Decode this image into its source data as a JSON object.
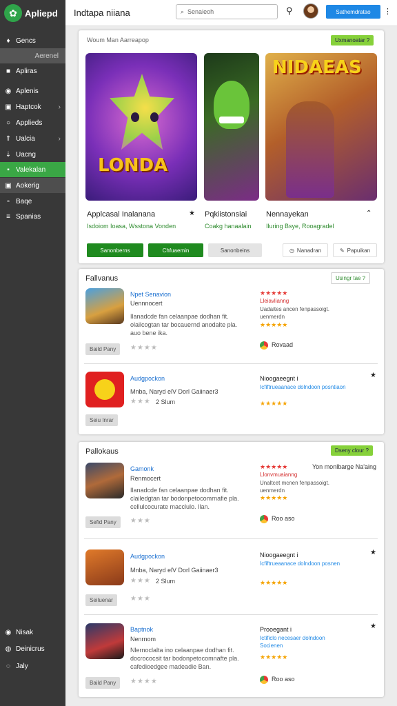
{
  "sidebar": {
    "logo": "Apliepd",
    "items": [
      {
        "label": "Gencs",
        "icon": "tag"
      },
      {
        "label": "Aerenel",
        "icon": ""
      },
      {
        "label": "Apliras",
        "icon": "square"
      },
      {
        "label": "Aplenis",
        "icon": "circle"
      },
      {
        "label": "Haptcok",
        "icon": "box"
      },
      {
        "label": "Applieds",
        "icon": "circle-o"
      },
      {
        "label": "Ualcia",
        "icon": "arrow"
      },
      {
        "label": "Uacng",
        "icon": "arrow-down"
      },
      {
        "label": "Valekalan",
        "icon": "square"
      },
      {
        "label": "Aokerig",
        "icon": "square"
      },
      {
        "label": "Baqe",
        "icon": "square"
      },
      {
        "label": "Spanias",
        "icon": "lines"
      }
    ],
    "bottom_items": [
      {
        "label": "Nisak"
      },
      {
        "label": "Deinicrus"
      },
      {
        "label": "Jaly"
      }
    ]
  },
  "topbar": {
    "title": "Indtapa niiana",
    "search_placeholder": "Senaieoh",
    "cta": "Sathemdratao"
  },
  "hero": {
    "header": "Woum Man Aarreapop",
    "badge": "Uxmanoatar ?",
    "image_labels": {
      "first": "LONDA",
      "third": "NIDAEAS"
    },
    "titles": [
      "Applcasal Inalanana",
      "Pqkiistonsiai",
      "Nennayekan"
    ],
    "subtitles": [
      "Isdoiom Ioasa, Wsstona Vonden",
      "Coakg hanaalain",
      "Iluring Bsye, Rooagradel"
    ],
    "buttons": [
      "Sanonberns",
      "Chfuaemin",
      "Sanonbeins"
    ],
    "actions": [
      "Nanadran",
      "Papuikan"
    ]
  },
  "section1": {
    "title": "Fallvanus",
    "badge": "Usingr tae ?",
    "rows": [
      {
        "name": "Npet Senavion",
        "sub": "Uennnocert",
        "desc": "Ilanadcde fan celaanpae dodhan fit. olailcogtan tar bocauernd anodalte pla. auo bene ika.",
        "pill": "Baild Pany",
        "rating_red": "★★★★★",
        "rating_red_text": "Lleiavlianng",
        "rating_note": "Uadaites ancen fenpassoigt. uenmerdn",
        "right_label": "Rovaad"
      },
      {
        "name": "Audgpockon",
        "sub": "Mnba, Naryd elV Dorl Gaiinaer3",
        "meta": "2 Slum",
        "pill": "Seiu Inrar",
        "right_head": "Nioogaeegnt i",
        "right_blue": "Icfiftrueaanace dolndoon posntiaon"
      }
    ]
  },
  "section2": {
    "title": "Pallokaus",
    "badge": "Dseny clour ?",
    "rows": [
      {
        "name": "Gamonk",
        "sub": "Renmocert",
        "desc": "Ilanadcde fan celaanpae dodhan fit. clailedgtan tar bodonpetocomrnafie pla. cellulcocurate macclulo. Ilan.",
        "pill": "Sefid Pany",
        "rating_text": "Yon monlbarge Na'aing",
        "rating_red_text": "Llonvmuaianng",
        "rating_note": "Unaltcet mcnen fenpassoigt. uenmerdn",
        "right_label": "Roo aso"
      },
      {
        "name": "Audgpockon",
        "sub": "Mnba, Naryd elV Dorl Gaiinaer3",
        "meta": "2 Slum",
        "pill": "Seiluenar",
        "right_head": "Nioogaeegnt i",
        "right_blue": "Icfiftrueaanace dolndoon posnen"
      },
      {
        "name": "Baptnok",
        "sub": "Nenrnom",
        "desc": "Nlernoclalta ino celaanpae dodhan fit. docrococsit tar bodonpetocomnafte pla. cafedioedgee madeadie Ban.",
        "pill": "Baild Pany",
        "right_head": "Prooegant i",
        "right_blue": "Ictificlo necesaer dolndoon Socienen",
        "right_label": "Roo aso"
      }
    ]
  },
  "colors": {
    "accent_green": "#3aa745",
    "blue": "#1e88e5",
    "badge": "#86d13a"
  }
}
